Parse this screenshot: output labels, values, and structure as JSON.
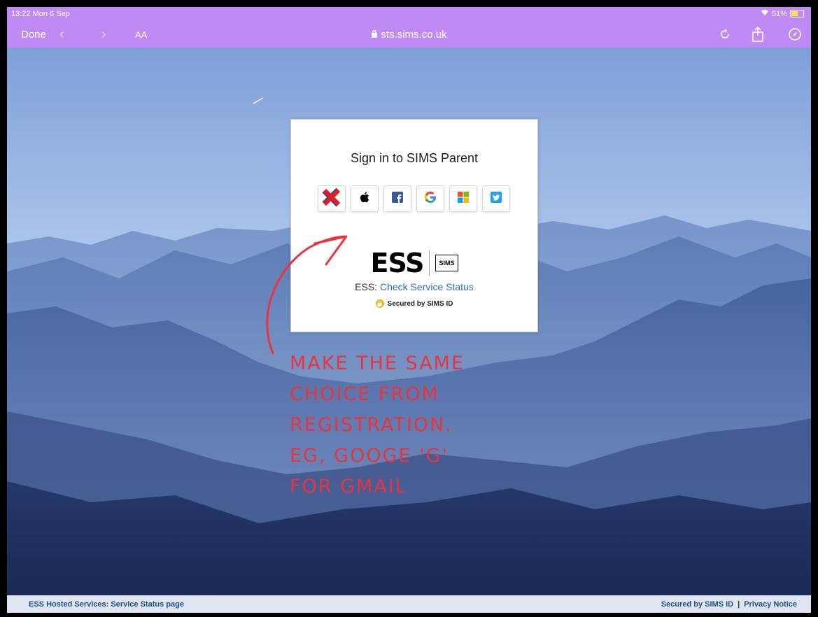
{
  "statusbar": {
    "time": "13:22  Mon 6 Sep",
    "battery": "51%"
  },
  "toolbar": {
    "done_label": "Done",
    "back_glyph": "‹",
    "forward_glyph": "›",
    "reader_label": "AA",
    "url": "sts.sims.co.uk",
    "icons": [
      "reload-icon",
      "share-icon",
      "compass-icon"
    ]
  },
  "card": {
    "title": "Sign in to SIMS Parent",
    "providers": [
      "red-cross-icon",
      "apple-icon",
      "facebook-icon",
      "google-icon",
      "microsoft-icon",
      "twitter-icon"
    ],
    "ess_logo": "ESS",
    "sims_logo": "SIMS",
    "status_prefix": "ESS:",
    "status_link": "Check Service Status",
    "secured": "Secured by SIMS ID"
  },
  "annotation": {
    "line1": "Make the same",
    "line2": "choice from",
    "line3": "Registration.",
    "line4": "Eg, Googe 'G'",
    "line5": "for Gmail",
    "color": "#e8343f"
  },
  "footer": {
    "left_link": "ESS Hosted Services: Service Status page",
    "right_link1": "Secured by SIMS ID",
    "divider": "|",
    "right_link2": "Privacy Notice"
  }
}
